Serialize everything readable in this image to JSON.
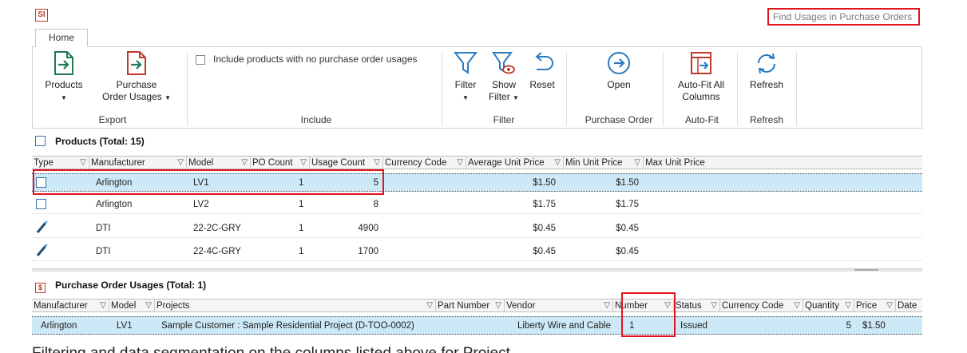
{
  "app": {
    "icon_text": "SI",
    "find_usages": "Find Usages in Purchase Orders",
    "tab": "Home"
  },
  "ribbon": {
    "products": "Products",
    "po_usages_1": "Purchase",
    "po_usages_2": "Order Usages",
    "export_group": "Export",
    "include_checkbox": "Include products with no purchase order usages",
    "include_group": "Include",
    "filter": "Filter",
    "show_filter_1": "Show",
    "show_filter_2": "Filter",
    "reset": "Reset",
    "filter_group": "Filter",
    "open": "Open",
    "po_group": "Purchase Order",
    "autofit_1": "Auto-Fit All",
    "autofit_2": "Columns",
    "autofit_group": "Auto-Fit",
    "refresh": "Refresh",
    "refresh_group": "Refresh"
  },
  "products": {
    "title": "Products (Total: 15)",
    "headers": [
      "Type",
      "Manufacturer",
      "Model",
      "PO Count",
      "Usage Count",
      "Currency Code",
      "Average Unit Price",
      "Min Unit Price",
      "Max Unit Price"
    ],
    "rows": [
      {
        "type": "box",
        "manufacturer": "Arlington",
        "model": "LV1",
        "po_count": "1",
        "usage": "5",
        "avg": "$1.50",
        "min": "$1.50"
      },
      {
        "type": "box",
        "manufacturer": "Arlington",
        "model": "LV2",
        "po_count": "1",
        "usage": "8",
        "avg": "$1.75",
        "min": "$1.75"
      },
      {
        "type": "cable",
        "manufacturer": "DTI",
        "model": "22-2C-GRY",
        "po_count": "1",
        "usage": "4900",
        "avg": "$0.45",
        "min": "$0.45"
      },
      {
        "type": "cable",
        "manufacturer": "DTI",
        "model": "22-4C-GRY",
        "po_count": "1",
        "usage": "1700",
        "avg": "$0.45",
        "min": "$0.45"
      }
    ]
  },
  "usages": {
    "icon_text": "$",
    "title": "Purchase Order Usages (Total: 1)",
    "headers": [
      "Manufacturer",
      "Model",
      "Projects",
      "Part Number",
      "Vendor",
      "Number",
      "Status",
      "Currency Code",
      "Quantity",
      "Price",
      "Date"
    ],
    "rows": [
      {
        "manufacturer": "Arlington",
        "model": "LV1",
        "projects": "Sample Customer : Sample Residential Project (D-TOO-0002)",
        "vendor": "Liberty Wire and Cable",
        "number": "1",
        "status": "Issued",
        "quantity": "5",
        "price": "$1.50"
      }
    ]
  },
  "caption": "Filtering and data segmentation on the columns listed above for Project"
}
